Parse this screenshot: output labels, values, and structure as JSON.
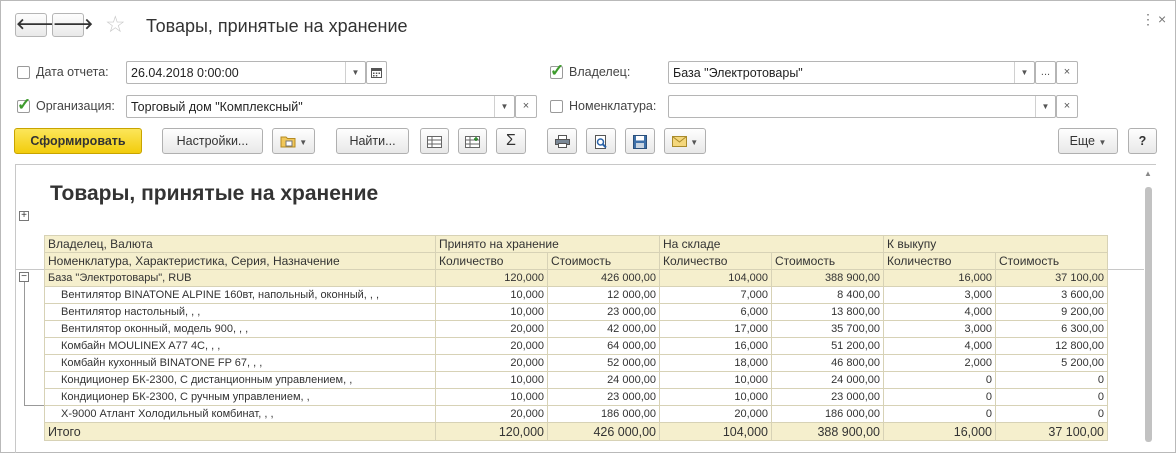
{
  "header": {
    "title": "Товары, принятые на хранение",
    "back_icon": "arrow-left",
    "forward_icon": "arrow-right"
  },
  "filters": {
    "report_date": {
      "label": "Дата отчета:",
      "checked": false,
      "value": "26.04.2018  0:00:00"
    },
    "owner": {
      "label": "Владелец:",
      "checked": true,
      "value": "База \"Электротовары\""
    },
    "organization": {
      "label": "Организация:",
      "checked": true,
      "value": "Торговый дом \"Комплексный\""
    },
    "nomenclature": {
      "label": "Номенклатура:",
      "checked": false,
      "value": ""
    }
  },
  "toolbar": {
    "generate": "Сформировать",
    "settings": "Настройки...",
    "find": "Найти...",
    "more": "Еще",
    "help": "?",
    "sum": "Σ"
  },
  "report": {
    "title": "Товары, принятые на хранение",
    "header1": [
      "Владелец, Валюта",
      "Принято на хранение",
      "На складе",
      "К выкупу"
    ],
    "header2": [
      "Номенклатура, Характеристика, Серия, Назначение",
      "Количество",
      "Стоимость",
      "Количество",
      "Стоимость",
      "Количество",
      "Стоимость"
    ],
    "group": [
      "База \"Электротовары\", RUB",
      "120,000",
      "426 000,00",
      "104,000",
      "388 900,00",
      "16,000",
      "37 100,00"
    ],
    "rows": [
      [
        "Вентилятор BINATONE ALPINE 160вт, напольный, оконный, , ,",
        "10,000",
        "12 000,00",
        "7,000",
        "8 400,00",
        "3,000",
        "3 600,00"
      ],
      [
        "Вентилятор настольный, , ,",
        "10,000",
        "23 000,00",
        "6,000",
        "13 800,00",
        "4,000",
        "9 200,00"
      ],
      [
        "Вентилятор оконный, модель 900, , ,",
        "20,000",
        "42 000,00",
        "17,000",
        "35 700,00",
        "3,000",
        "6 300,00"
      ],
      [
        "Комбайн MOULINEX  A77 4C, , ,",
        "20,000",
        "64 000,00",
        "16,000",
        "51 200,00",
        "4,000",
        "12 800,00"
      ],
      [
        "Комбайн кухонный BINATONE FP 67, , ,",
        "20,000",
        "52 000,00",
        "18,000",
        "46 800,00",
        "2,000",
        "5 200,00"
      ],
      [
        "Кондиционер БК-2300, С дистанционным управлением, ,",
        "10,000",
        "24 000,00",
        "10,000",
        "24 000,00",
        "0",
        "0"
      ],
      [
        "Кондиционер БК-2300, С ручным управлением, ,",
        "10,000",
        "23 000,00",
        "10,000",
        "23 000,00",
        "0",
        "0"
      ],
      [
        "Х-9000 Атлант Холодильный комбинат, , ,",
        "20,000",
        "186 000,00",
        "20,000",
        "186 000,00",
        "0",
        "0"
      ]
    ],
    "total": [
      "Итого",
      "120,000",
      "426 000,00",
      "104,000",
      "388 900,00",
      "16,000",
      "37 100,00"
    ]
  }
}
